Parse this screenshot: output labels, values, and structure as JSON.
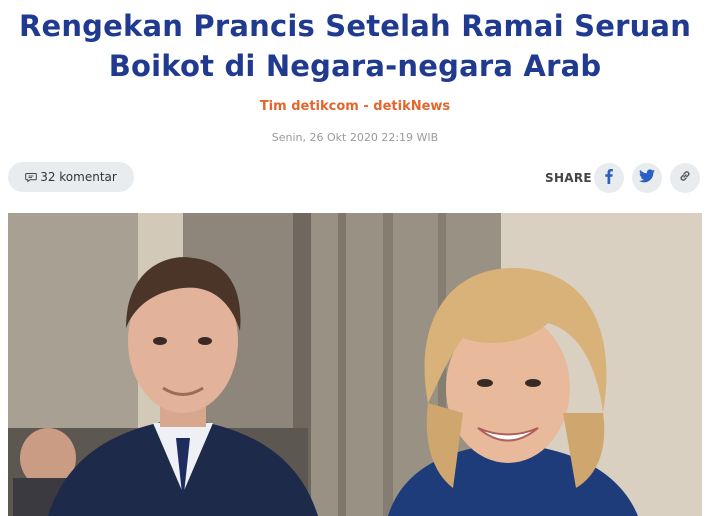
{
  "article": {
    "title_line1": "Rengekan Prancis Setelah Ramai Seruan",
    "title_line2": "Boikot di Negara-negara Arab",
    "author": "Tim detikcom - detikNews",
    "date": "Senin, 26 Okt 2020 22:19 WIB"
  },
  "toolbar": {
    "comment_count_label": "32 komentar",
    "share_label": "SHARE",
    "share_icons": [
      "facebook-icon",
      "twitter-icon",
      "link-icon"
    ]
  },
  "colors": {
    "title": "#1f3a8f",
    "author": "#e5652e",
    "date": "#9a9a9a",
    "button_bg": "#e9ecef",
    "icon": "#2b5fc1"
  }
}
